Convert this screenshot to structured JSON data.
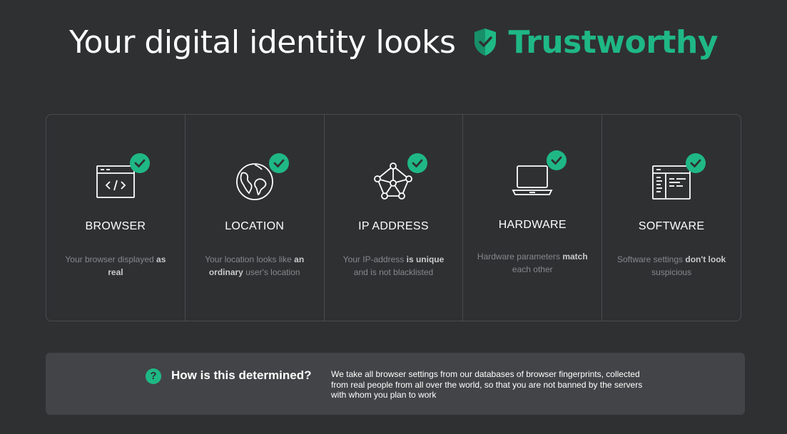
{
  "header": {
    "lead": "Your digital identity looks",
    "verdict": "Trustworthy"
  },
  "cards": [
    {
      "title": "BROWSER",
      "desc_before": "Your browser displayed ",
      "desc_bold": "as real",
      "desc_after": ""
    },
    {
      "title": "LOCATION",
      "desc_before": "Your location looks like ",
      "desc_bold": "an ordinary",
      "desc_after": " user's location"
    },
    {
      "title": "IP ADDRESS",
      "desc_before": "Your IP-address ",
      "desc_bold": "is unique",
      "desc_after": " and is not blacklisted"
    },
    {
      "title": "HARDWARE",
      "desc_before": "Hardware parameters ",
      "desc_bold": "match",
      "desc_after": " each other"
    },
    {
      "title": "SOFTWARE",
      "desc_before": "Software settings ",
      "desc_bold": "don't look",
      "desc_after": " suspicious"
    }
  ],
  "info": {
    "icon_glyph": "?",
    "question": "How is this determined?",
    "answer": "We take all browser settings from our databases of browser fingerprints, collected from real people from all over the world, so that you are not banned by the servers with whom you plan to work"
  },
  "colors": {
    "accent": "#1fb885",
    "background": "#2f3032",
    "panel": "#434447"
  }
}
